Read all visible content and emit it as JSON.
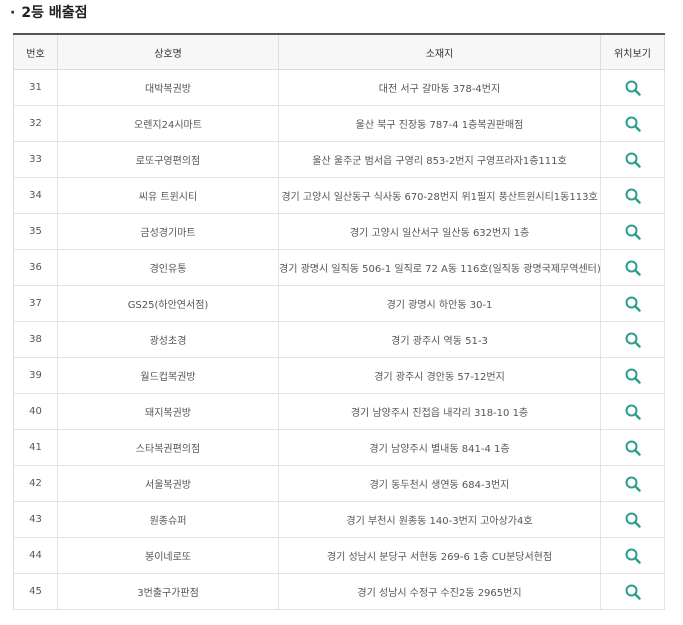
{
  "section": {
    "bullet": "·",
    "title": "2등 배출점"
  },
  "table": {
    "headers": {
      "no": "번호",
      "name": "상호명",
      "address": "소재지",
      "map": "위치보기"
    },
    "rows": [
      {
        "no": "31",
        "name": "대박복권방",
        "address": "대전 서구 갈마동 378-4번지"
      },
      {
        "no": "32",
        "name": "오렌지24시마트",
        "address": "울산 북구 진장동 787-4 1층복권판매점"
      },
      {
        "no": "33",
        "name": "로또구영편의점",
        "address": "울산 울주군 범서읍 구영리 853-2번지 구영프라자1층111호"
      },
      {
        "no": "34",
        "name": "씨유 트윈시티",
        "address": "경기 고양시 일산동구 식사동 670-28번지 위1필지 풍산트윈시티1동113호"
      },
      {
        "no": "35",
        "name": "금성경기마트",
        "address": "경기 고양시 일산서구 일산동 632번지 1층"
      },
      {
        "no": "36",
        "name": "경인유통",
        "address": "경기 광명시 일직동 506-1 일직로 72 A동 116호(일직동 광명국제무역센터)"
      },
      {
        "no": "37",
        "name": "GS25(하안연서점)",
        "address": "경기 광명시 하안동 30-1"
      },
      {
        "no": "38",
        "name": "광성초경",
        "address": "경기 광주시 역동 51-3"
      },
      {
        "no": "39",
        "name": "월드컵복권방",
        "address": "경기 광주시 경안동 57-12번지"
      },
      {
        "no": "40",
        "name": "돼지복권방",
        "address": "경기 남양주시 진접읍 내각리 318-10 1층"
      },
      {
        "no": "41",
        "name": "스타복권편의점",
        "address": "경기 남양주시 별내동 841-4 1층"
      },
      {
        "no": "42",
        "name": "서울복권방",
        "address": "경기 동두천시 생연동 684-3번지"
      },
      {
        "no": "43",
        "name": "원종슈퍼",
        "address": "경기 부천시 원종동 140-3번지 고아상가4호"
      },
      {
        "no": "44",
        "name": "봉이네로또",
        "address": "경기 성남시 분당구 서현동 269-6 1층 CU분당서현점"
      },
      {
        "no": "45",
        "name": "3번출구가판점",
        "address": "경기 성남시 수정구 수진2동 2965번지"
      }
    ]
  },
  "icon": {
    "name": "search-icon",
    "color": "#2a9d8f"
  }
}
